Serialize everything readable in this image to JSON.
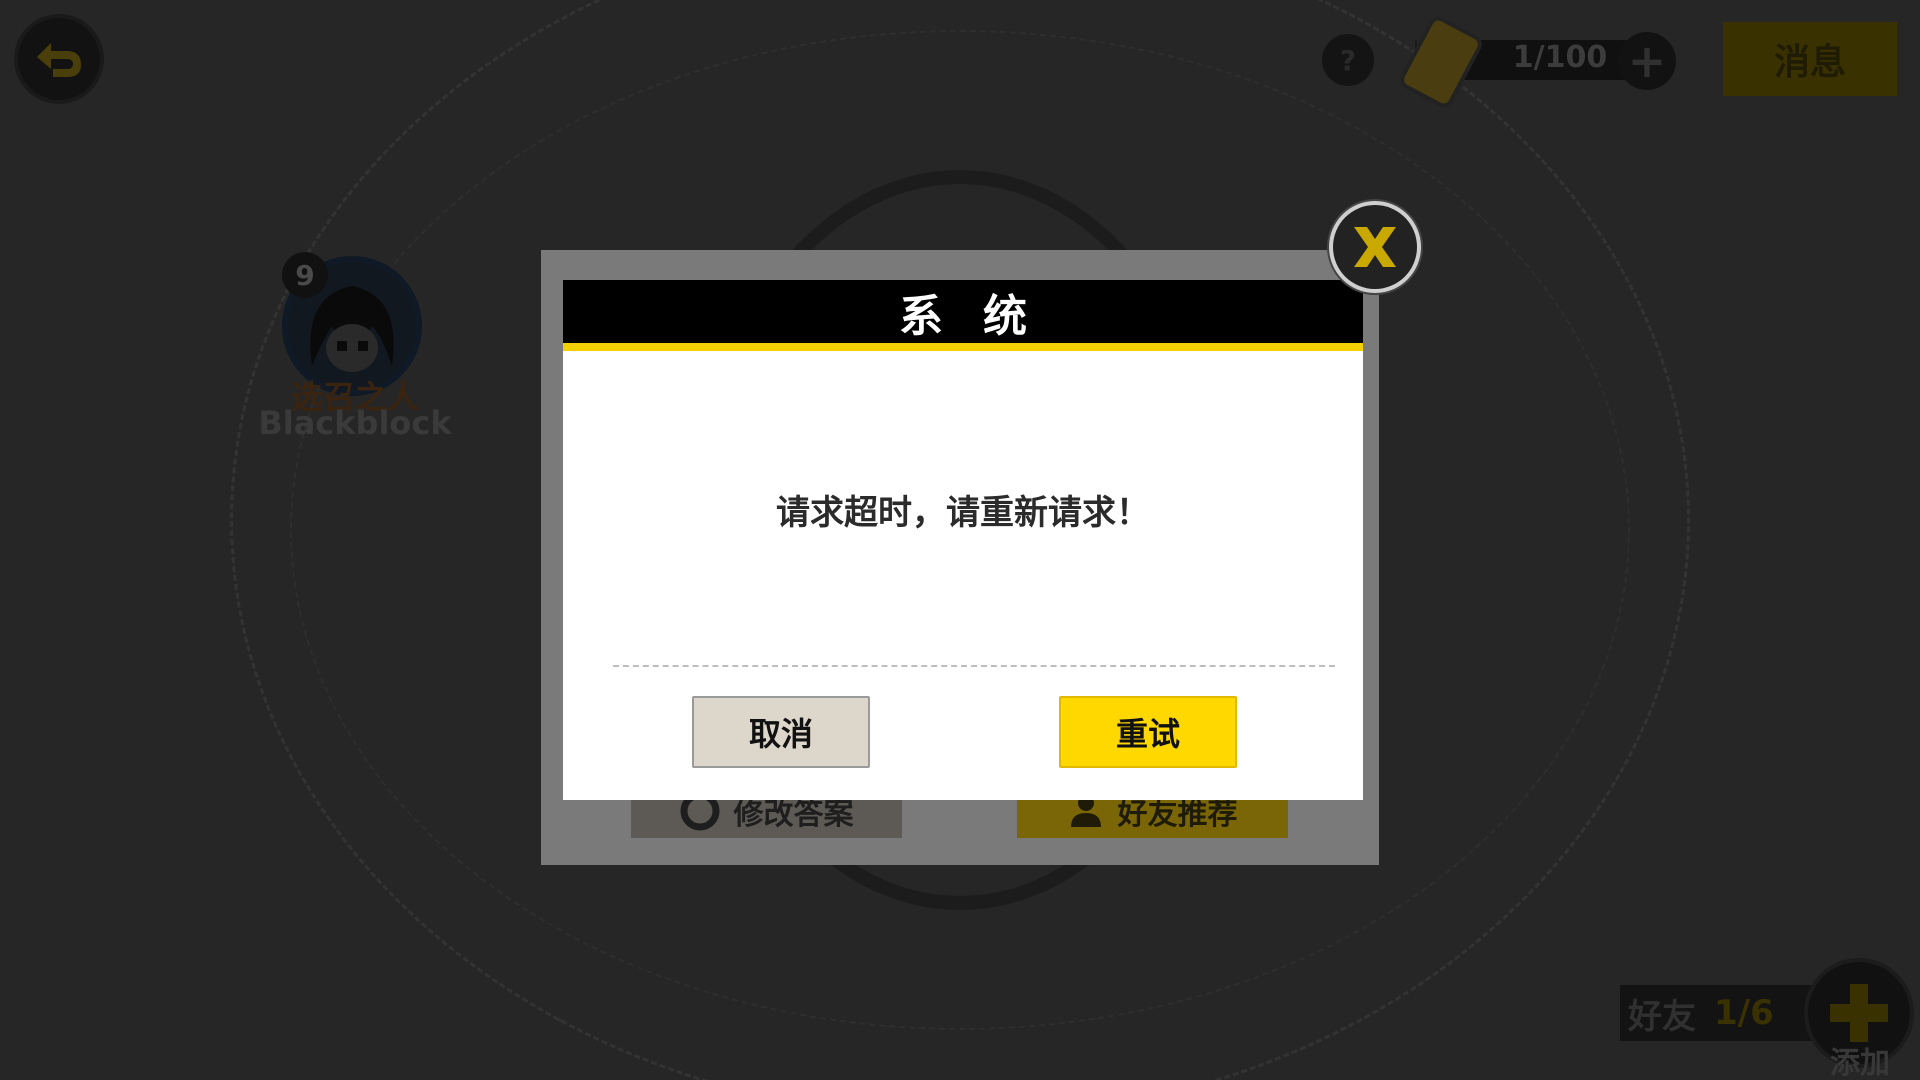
{
  "topbar": {
    "help_label": "?",
    "stamina_text": "1/100",
    "stamina_fraction": 0.01,
    "stamina_add_label": "+",
    "messages_label": "消息"
  },
  "friend": {
    "level": "9",
    "title": "选召之人",
    "name": "Blackblock"
  },
  "behind_dialog": {
    "edit_label": "修改答案",
    "recommend_label": "好友推荐"
  },
  "friends_counter": {
    "label": "好友",
    "count": "1/6",
    "add_label": "添加"
  },
  "dialog": {
    "title": "系统",
    "message": "请求超时，请重新请求！",
    "cancel_label": "取消",
    "retry_label": "重试"
  },
  "colors": {
    "accent_yellow": "#ffd800",
    "header_black": "#000000",
    "overlay_dark": "#262626"
  },
  "icons": {
    "back": "back-arrow-icon",
    "close": "close-x-icon",
    "help": "question-icon",
    "stamina": "battery-icon",
    "add": "plus-icon"
  }
}
